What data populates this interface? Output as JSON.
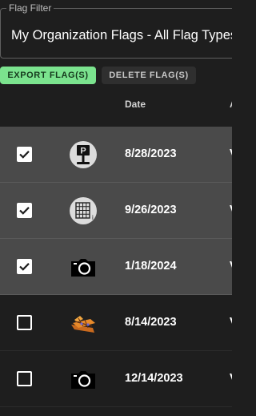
{
  "filter": {
    "label": "Flag Filter",
    "value": "My Organization Flags - All Flag Types"
  },
  "buttons": {
    "export_label": "EXPORT FLAG(S)",
    "delete_label": "DELETE FLAG(S)"
  },
  "table": {
    "columns": [
      "Date",
      "A"
    ],
    "rows": [
      {
        "selected": true,
        "icon": "parking-sign-icon",
        "date": "8/28/2023",
        "trail": "V"
      },
      {
        "selected": true,
        "icon": "grid-info-icon",
        "date": "9/26/2023",
        "trail": "V"
      },
      {
        "selected": true,
        "icon": "camera-icon",
        "date": "1/18/2024",
        "trail": "V"
      },
      {
        "selected": false,
        "icon": "construction-site-icon",
        "date": "8/14/2023",
        "trail": "V"
      },
      {
        "selected": false,
        "icon": "camera-icon",
        "date": "12/14/2023",
        "trail": "V"
      }
    ]
  },
  "colors": {
    "export_button_bg": "#7be38e",
    "background": "#1e1e1e",
    "selected_row": "#4a4a4a"
  }
}
